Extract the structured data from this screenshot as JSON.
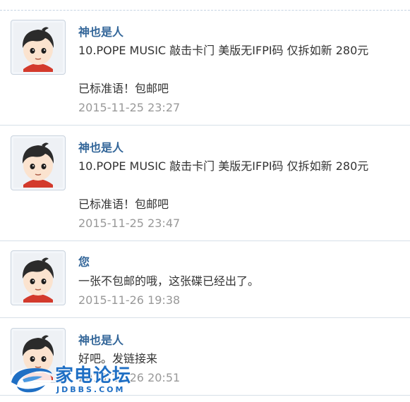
{
  "messages": [
    {
      "name": "神也是人",
      "lines": [
        "10.POPE MUSIC 敲击卡门 美版无IFPI码 仅拆如新 280元",
        "",
        "已标准语！包邮吧"
      ],
      "time": "2015-11-25 23:27"
    },
    {
      "name": "神也是人",
      "lines": [
        "10.POPE MUSIC 敲击卡门 美版无IFPI码 仅拆如新 280元",
        "",
        "已标准语！包邮吧"
      ],
      "time": "2015-11-25 23:47"
    },
    {
      "name": "您",
      "lines": [
        "一张不包邮的哦，这张碟已经出了。"
      ],
      "time": "2015-11-26 19:38"
    },
    {
      "name": "神也是人",
      "lines": [
        "好吧。发链接来"
      ],
      "time": "2015-11-26 20:51"
    }
  ],
  "watermark": {
    "title": "家电论坛",
    "subtitle": "JDBBS.COM"
  },
  "colors": {
    "name": "#336699",
    "text": "#333333",
    "time": "#999999",
    "divider": "#d7e0e8"
  }
}
